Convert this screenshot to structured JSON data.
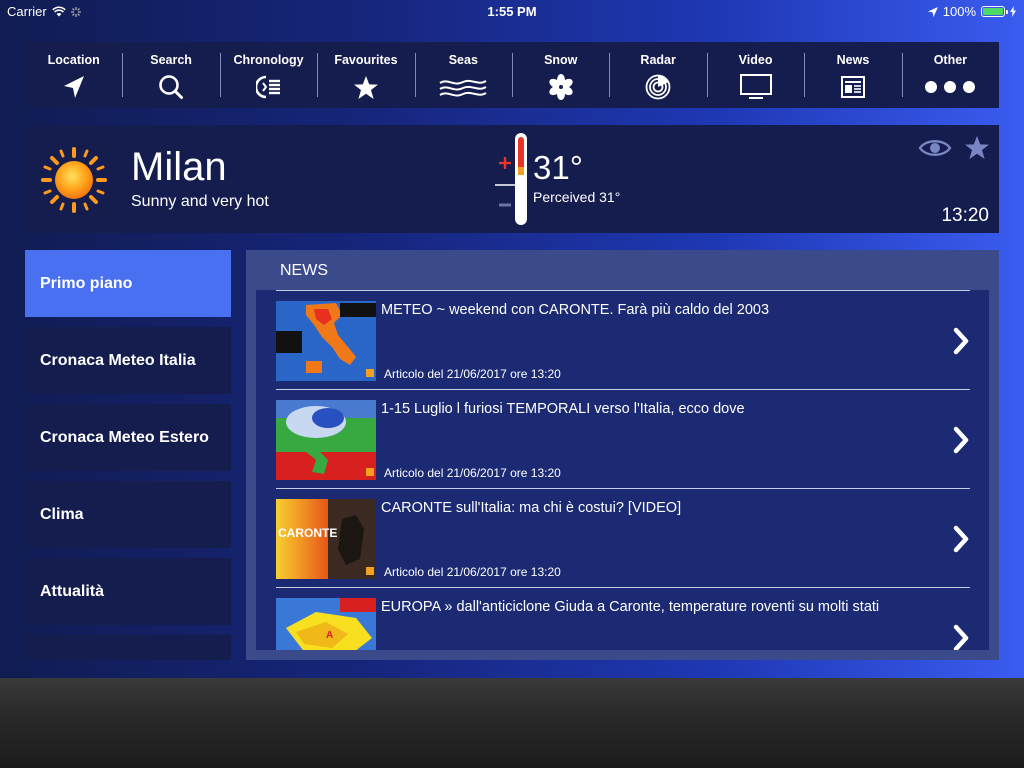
{
  "status_bar": {
    "carrier": "Carrier",
    "time": "1:55 PM",
    "battery": "100%"
  },
  "nav": {
    "tabs": [
      {
        "label": "Location",
        "icon": "location-arrow-icon"
      },
      {
        "label": "Search",
        "icon": "search-icon"
      },
      {
        "label": "Chronology",
        "icon": "chronology-icon"
      },
      {
        "label": "Favourites",
        "icon": "star-icon"
      },
      {
        "label": "Seas",
        "icon": "waves-icon"
      },
      {
        "label": "Snow",
        "icon": "snowflake-icon"
      },
      {
        "label": "Radar",
        "icon": "radar-icon"
      },
      {
        "label": "Video",
        "icon": "tv-icon"
      },
      {
        "label": "News",
        "icon": "newspaper-icon"
      },
      {
        "label": "Other",
        "icon": "dots-icon"
      }
    ]
  },
  "weather": {
    "city": "Milan",
    "condition": "Sunny and very hot",
    "temperature": "31°",
    "perceived": "Perceived 31°",
    "time": "13:20",
    "icons": {
      "condition": "sun-icon",
      "thermometer": "thermometer-icon",
      "watch": "eye-icon",
      "favourite": "star-icon"
    }
  },
  "sidebar": {
    "items": [
      {
        "label": "Primo piano",
        "active": true
      },
      {
        "label": "Cronaca Meteo Italia",
        "active": false
      },
      {
        "label": "Cronaca Meteo Estero",
        "active": false
      },
      {
        "label": "Clima",
        "active": false
      },
      {
        "label": "Attualità",
        "active": false
      },
      {
        "label": "",
        "active": false
      }
    ]
  },
  "news": {
    "heading": "NEWS",
    "articles": [
      {
        "title": "METEO ~ weekend con CARONTE. Farà più caldo del 2003",
        "date": "Articolo del 21/06/2017 ore 13:20"
      },
      {
        "title": "1-15 Luglio l furiosi TEMPORALI verso l'Italia, ecco dove",
        "date": "Articolo del 21/06/2017 ore 13:20"
      },
      {
        "title": "CARONTE sull'Italia: ma chi è costui? [VIDEO]",
        "date": "Articolo del 21/06/2017 ore 13:20"
      },
      {
        "title": "EUROPA » dall'anticiclone Giuda a Caronte, temperature roventi su molti stati",
        "date": ""
      }
    ],
    "thumb_texts": [
      "CARONTE",
      "A"
    ]
  },
  "colors": {
    "accent": "#4a70f2",
    "panel": "#141d4e",
    "list": "#1b2a73",
    "hot": "#e8552a"
  }
}
